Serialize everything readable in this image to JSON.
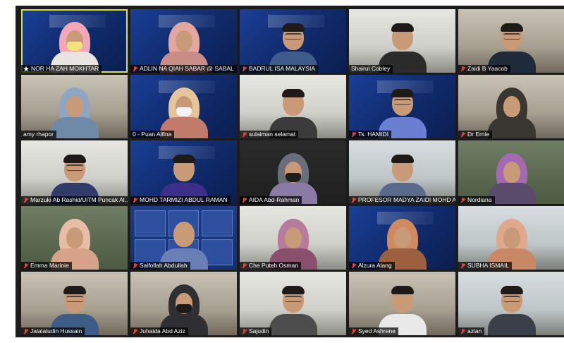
{
  "meeting": {
    "participants": [
      {
        "name": "NOR HA ZAH MOKHTAR",
        "muted": false,
        "active": true,
        "bg": "bg-blue",
        "style": "hijab",
        "hijab": "#f3a7b8",
        "shirt": "#e9e4e0",
        "mask": "#f2e27a"
      },
      {
        "name": "ADLIN NA QIAH SABAR @ SABAL",
        "muted": true,
        "active": false,
        "bg": "bg-blue",
        "style": "hijab",
        "hijab": "#e4a7a0",
        "shirt": "#c98c86",
        "mask": ""
      },
      {
        "name": "BADRUL ISA  MALAYSIA",
        "muted": true,
        "active": false,
        "bg": "bg-blue",
        "style": "man",
        "hijab": "",
        "shirt": "#3f5b8a",
        "mask": ""
      },
      {
        "name": "Shairul Cobley",
        "muted": false,
        "active": false,
        "bg": "bg-office",
        "style": "man",
        "hijab": "",
        "shirt": "#2b2b2b",
        "mask": ""
      },
      {
        "name": "Zaidi B Yaacob",
        "muted": true,
        "active": false,
        "bg": "bg-room",
        "style": "man",
        "hijab": "",
        "shirt": "#1f2a3a",
        "mask": ""
      },
      {
        "name": "amy rhapor",
        "muted": false,
        "active": false,
        "bg": "bg-room",
        "style": "hijab",
        "hijab": "#8fa6c2",
        "shirt": "#6f8aa8",
        "mask": ""
      },
      {
        "name": "0 - Puan Alfina",
        "muted": false,
        "active": false,
        "bg": "bg-blue",
        "style": "hijab",
        "hijab": "#e6c59a",
        "shirt": "#c27a6a",
        "mask": "#f4f4f4"
      },
      {
        "name": "sulaiman selamat",
        "muted": true,
        "active": false,
        "bg": "bg-office",
        "style": "man",
        "hijab": "",
        "shirt": "#3b3b3b",
        "mask": ""
      },
      {
        "name": "Ts. HAMIDI",
        "muted": true,
        "active": false,
        "bg": "bg-blue",
        "style": "man",
        "hijab": "",
        "shirt": "#6a7fd1",
        "mask": ""
      },
      {
        "name": "Dr Ernie",
        "muted": true,
        "active": false,
        "bg": "bg-room",
        "style": "hijab",
        "hijab": "#3a3631",
        "shirt": "#3a3631",
        "mask": ""
      },
      {
        "name": "Marzuki Ab Rashid/UiTM Puncak Al...",
        "muted": true,
        "active": false,
        "bg": "bg-office",
        "style": "man",
        "hijab": "",
        "shirt": "#2f3c69",
        "mask": ""
      },
      {
        "name": "MOHD TARMIZI ABDUL RAMAN",
        "muted": true,
        "active": false,
        "bg": "bg-blue",
        "style": "man",
        "hijab": "",
        "shirt": "#3c2f8a",
        "mask": ""
      },
      {
        "name": "AIDA Abd-Rahman",
        "muted": true,
        "active": false,
        "bg": "bg-dark",
        "style": "hijab",
        "hijab": "#6a6e78",
        "shirt": "#8b7aa6",
        "mask": "#1e1e1e"
      },
      {
        "name": "PROFESOR MADYA ZAIDI MOHD AMI...",
        "muted": true,
        "active": false,
        "bg": "bg-window",
        "style": "man",
        "hijab": "",
        "shirt": "#5a6a8a",
        "mask": ""
      },
      {
        "name": "Nordiana",
        "muted": true,
        "active": false,
        "bg": "bg-green",
        "style": "hijab",
        "hijab": "#a46ab1",
        "shirt": "#5a4b6c",
        "mask": ""
      },
      {
        "name": "Emma Marinie",
        "muted": true,
        "active": false,
        "bg": "bg-green",
        "style": "hijab",
        "hijab": "#e8bda6",
        "shirt": "#d7a28a",
        "mask": ""
      },
      {
        "name": "Saifollah Abdullah",
        "muted": true,
        "active": false,
        "bg": "bg-slides",
        "style": "slides",
        "hijab": "",
        "shirt": "#6a7fb5",
        "mask": ""
      },
      {
        "name": "Che Puteh Osman",
        "muted": true,
        "active": false,
        "bg": "bg-office",
        "style": "hijab",
        "hijab": "#b77b9c",
        "shirt": "#8a4f6d",
        "mask": ""
      },
      {
        "name": "Alzura Alang",
        "muted": true,
        "active": false,
        "bg": "bg-blue",
        "style": "hijab",
        "hijab": "#d08a5f",
        "shirt": "#9c5f3f",
        "mask": ""
      },
      {
        "name": "SUBHA ISMAIL",
        "muted": true,
        "active": false,
        "bg": "bg-window",
        "style": "hijab",
        "hijab": "#e0a88c",
        "shirt": "#c88866",
        "mask": ""
      },
      {
        "name": "Jalalaludin Hussain",
        "muted": true,
        "active": false,
        "bg": "bg-room",
        "style": "man",
        "hijab": "",
        "shirt": "#3e5c86",
        "mask": ""
      },
      {
        "name": "Juhaida Abd Aziz",
        "muted": true,
        "active": false,
        "bg": "bg-room",
        "style": "hijab",
        "hijab": "#2f2f33",
        "shirt": "#2f2f33",
        "mask": "#1b1b1b"
      },
      {
        "name": "Sajudin",
        "muted": true,
        "active": false,
        "bg": "bg-office",
        "style": "man",
        "hijab": "",
        "shirt": "#4d4d4d",
        "mask": ""
      },
      {
        "name": "Syed Ashrene",
        "muted": true,
        "active": false,
        "bg": "bg-room",
        "style": "man",
        "hijab": "",
        "shirt": "#e9e9e9",
        "mask": ""
      },
      {
        "name": "azlan",
        "muted": true,
        "active": false,
        "bg": "bg-window",
        "style": "man",
        "hijab": "",
        "shirt": "#3a3f4a",
        "mask": ""
      }
    ]
  }
}
